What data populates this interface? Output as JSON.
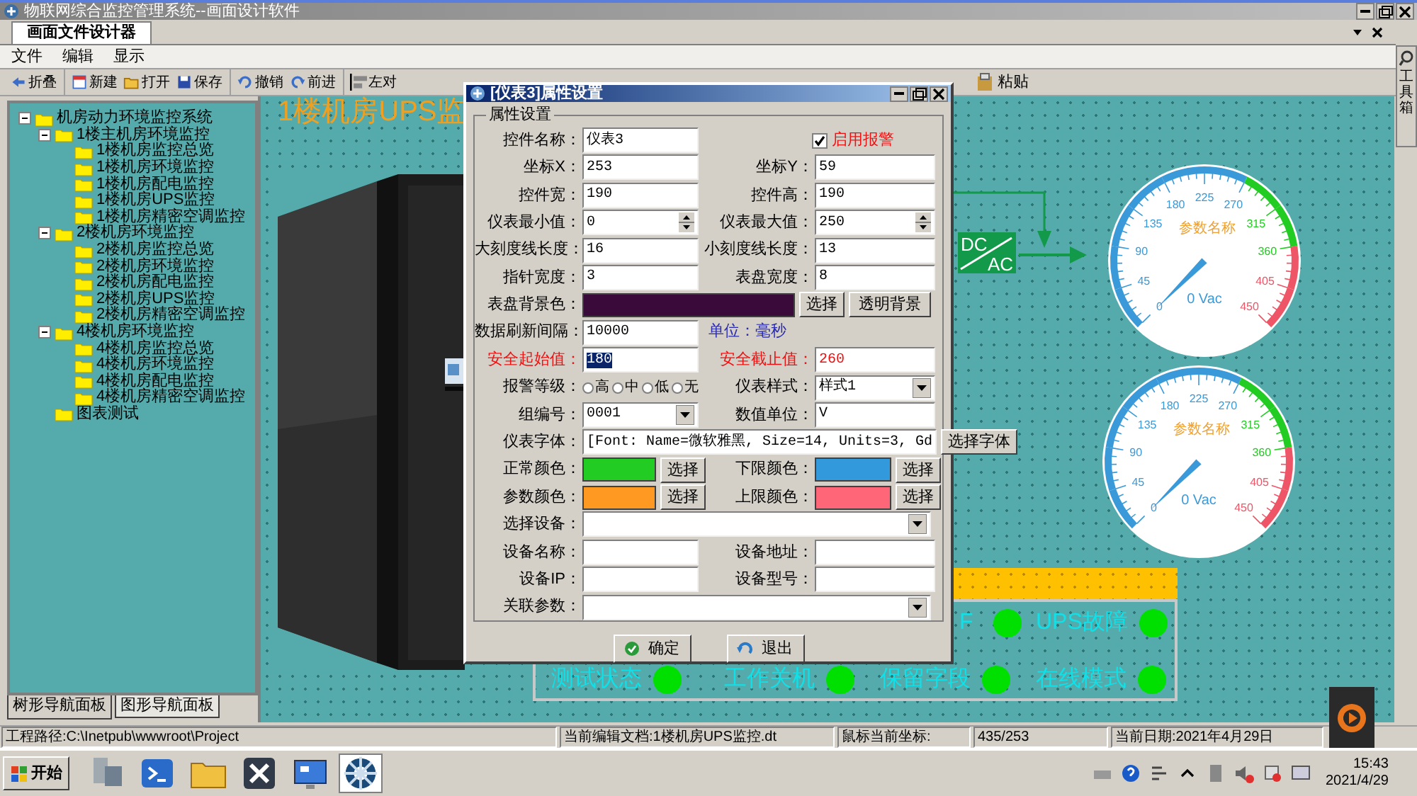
{
  "window": {
    "title": "物联网综合监控管理系统--画面设计软件"
  },
  "doc_tab": {
    "label": "画面文件设计器",
    "selected": true
  },
  "menu": [
    "文件",
    "编辑",
    "显示"
  ],
  "toolbar": [
    "折叠",
    "新建",
    "打开",
    "保存",
    "撤销",
    "前进",
    "左对"
  ],
  "toolbar_end": [
    "粘贴"
  ],
  "toolbox": {
    "label": "工具箱"
  },
  "tree": [
    {
      "label": "机房动力环境监控系统",
      "expanded": true,
      "children": [
        {
          "label": "1楼主机房环境监控",
          "expanded": true,
          "children": [
            {
              "label": "1楼机房监控总览"
            },
            {
              "label": "1楼机房环境监控"
            },
            {
              "label": "1楼机房配电监控"
            },
            {
              "label": "1楼机房UPS监控"
            },
            {
              "label": "1楼机房精密空调监控"
            }
          ]
        },
        {
          "label": "2楼机房环境监控",
          "expanded": true,
          "children": [
            {
              "label": "2楼机房监控总览"
            },
            {
              "label": "2楼机房环境监控"
            },
            {
              "label": "2楼机房配电监控"
            },
            {
              "label": "2楼机房UPS监控"
            },
            {
              "label": "2楼机房精密空调监控"
            }
          ]
        },
        {
          "label": "4楼机房环境监控",
          "expanded": true,
          "children": [
            {
              "label": "4楼机房监控总览"
            },
            {
              "label": "4楼机房环境监控"
            },
            {
              "label": "4楼机房配电监控"
            },
            {
              "label": "4楼机房精密空调监控"
            }
          ]
        },
        {
          "label": "图表测试"
        }
      ]
    }
  ],
  "panel_tabs": [
    {
      "label": "树形导航面板",
      "selected": true
    },
    {
      "label": "图形导航面板",
      "selected": false
    }
  ],
  "canvas": {
    "title": "1楼机房UPS监",
    "converter": {
      "top": "DC",
      "bottom": "AC"
    },
    "gauges": [
      {
        "title": "参数名称",
        "reading": "0 Vac",
        "scale": [
          {
            "label": "0",
            "color": "#3a9ad9"
          },
          {
            "label": "45",
            "color": "#3a9ad9"
          },
          {
            "label": "90",
            "color": "#3a9ad9"
          },
          {
            "label": "135",
            "color": "#3a9ad9"
          },
          {
            "label": "180",
            "color": "#3a9ad9"
          },
          {
            "label": "225",
            "color": "#3a9ad9"
          },
          {
            "label": "270",
            "color": "#3a9ad9"
          },
          {
            "label": "315",
            "color": "#22cc22"
          },
          {
            "label": "360",
            "color": "#22cc22"
          },
          {
            "label": "405",
            "color": "#ee5566"
          },
          {
            "label": "450",
            "color": "#ee5566"
          }
        ]
      },
      {
        "title": "参数名称",
        "reading": "0 Vac",
        "scale": [
          {
            "label": "0",
            "color": "#3a9ad9"
          },
          {
            "label": "45",
            "color": "#3a9ad9"
          },
          {
            "label": "90",
            "color": "#3a9ad9"
          },
          {
            "label": "135",
            "color": "#3a9ad9"
          },
          {
            "label": "180",
            "color": "#3a9ad9"
          },
          {
            "label": "225",
            "color": "#3a9ad9"
          },
          {
            "label": "270",
            "color": "#3a9ad9"
          },
          {
            "label": "315",
            "color": "#22cc22"
          },
          {
            "label": "360",
            "color": "#22cc22"
          },
          {
            "label": "405",
            "color": "#ee5566"
          },
          {
            "label": "450",
            "color": "#ee5566"
          }
        ]
      }
    ],
    "status_lights": [
      {
        "label": "F",
        "on": true
      },
      {
        "label": "UPS故障",
        "on": true
      },
      {
        "label": "测试状态",
        "on": true
      },
      {
        "label": "工作关机",
        "on": true
      },
      {
        "label": "保留字段",
        "on": true
      },
      {
        "label": "在线模式",
        "on": true
      }
    ]
  },
  "dialog": {
    "title": "[仪表3]属性设置",
    "group": "属性设置",
    "rows": [
      [
        {
          "label": "控件名称：",
          "kind": "text",
          "value": "仪表3"
        },
        {
          "kind": "checkbox",
          "label": "启用报警",
          "checked": true,
          "warning": true
        }
      ],
      [
        {
          "label": "坐标X：",
          "kind": "text",
          "value": "253"
        },
        {
          "label": "坐标Y：",
          "kind": "text",
          "value": "59"
        }
      ],
      [
        {
          "label": "控件宽：",
          "kind": "text",
          "value": "190"
        },
        {
          "label": "控件高：",
          "kind": "text",
          "value": "190"
        }
      ],
      [
        {
          "label": "仪表最小值：",
          "kind": "spin",
          "value": "0"
        },
        {
          "label": "仪表最大值：",
          "kind": "spin",
          "value": "250"
        }
      ],
      [
        {
          "label": "大刻度线长度：",
          "kind": "text",
          "value": "16"
        },
        {
          "label": "小刻度线长度：",
          "kind": "text",
          "value": "13"
        }
      ],
      [
        {
          "label": "指针宽度：",
          "kind": "text",
          "value": "3"
        },
        {
          "label": "表盘宽度：",
          "kind": "text",
          "value": "8"
        }
      ],
      [
        {
          "label": "表盘背景色：",
          "kind": "swatch",
          "color": "#3a0a3a",
          "buttons": [
            "选择",
            "透明背景"
          ]
        }
      ],
      [
        {
          "label": "数据刷新间隔：",
          "kind": "text",
          "value": "10000"
        },
        {
          "kind": "note",
          "label": "单位：毫秒"
        }
      ],
      [
        {
          "label": "安全起始值：",
          "kind": "text",
          "value": "180",
          "warning": true,
          "highlighted": true
        },
        {
          "label": "安全截止值：",
          "kind": "text",
          "value": "260",
          "warning": true
        }
      ],
      [
        {
          "label": "报警等级：",
          "kind": "radios",
          "options": [
            {
              "label": "高",
              "selected": false
            },
            {
              "label": "中",
              "selected": false
            },
            {
              "label": "低",
              "selected": false
            },
            {
              "label": "无",
              "selected": false
            }
          ]
        },
        {
          "label": "仪表样式：",
          "kind": "combo",
          "value": "样式1"
        }
      ],
      [
        {
          "label": "组编号：",
          "kind": "combo",
          "value": "0001"
        },
        {
          "label": "数值单位：",
          "kind": "text",
          "value": "V"
        }
      ],
      [
        {
          "label": "仪表字体：",
          "kind": "text",
          "value": "[Font: Name=微软雅黑, Size=14, Units=3, Gd",
          "buttons": [
            "选择字体"
          ]
        }
      ],
      [
        {
          "label": "正常颜色：",
          "kind": "swatch",
          "color": "#22cc22",
          "buttons": [
            "选择"
          ]
        },
        {
          "label": "下限颜色：",
          "kind": "swatch",
          "color": "#3399dd",
          "buttons": [
            "选择"
          ]
        }
      ],
      [
        {
          "label": "参数颜色：",
          "kind": "swatch",
          "color": "#ff9922",
          "buttons": [
            "选择"
          ]
        },
        {
          "label": "上限颜色：",
          "kind": "swatch",
          "color": "#ff6677",
          "buttons": [
            "选择"
          ]
        }
      ],
      [
        {
          "label": "选择设备：",
          "kind": "combo"
        }
      ],
      [
        {
          "label": "设备名称：",
          "kind": "text"
        },
        {
          "label": "设备地址：",
          "kind": "text"
        }
      ],
      [
        {
          "label": "设备IP：",
          "kind": "text"
        },
        {
          "label": "设备型号：",
          "kind": "text"
        }
      ],
      [
        {
          "label": "关联参数：",
          "kind": "combo"
        }
      ]
    ],
    "buttons": [
      "确定",
      "退出"
    ]
  },
  "status_bar": [
    "工程路径:C:\\Inetpub\\wwwroot\\Project",
    "当前编辑文档:1楼机房UPS监控.dt",
    "鼠标当前坐标:",
    "435/253",
    "当前日期:2021年4月29日"
  ],
  "taskbar": {
    "start": "开始",
    "time": "15:43",
    "date": "2021/4/29"
  }
}
